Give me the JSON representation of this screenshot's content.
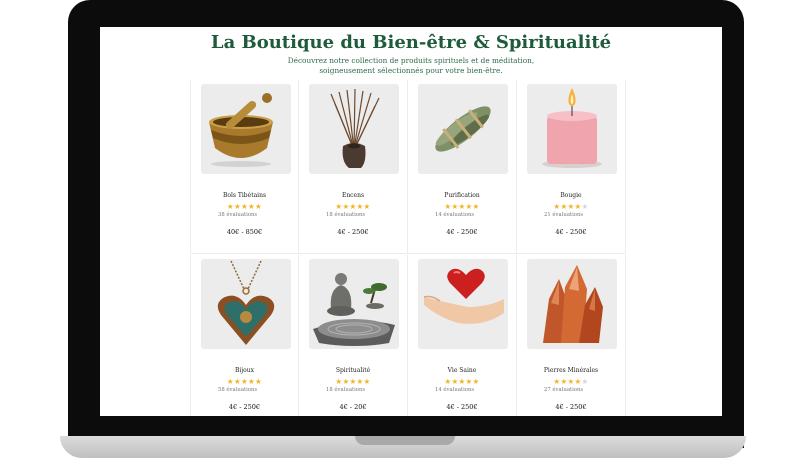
{
  "page": {
    "title": "La Boutique du Bien-être & Spiritualité",
    "subtitle_line1": "Découvrez notre collection de produits spirituels et de méditation,",
    "subtitle_line2": "soigneusement sélectionnés pour votre bien-être."
  },
  "products": [
    {
      "name": "Bols Tibétains",
      "rating": 5,
      "reviews": "38 évaluations",
      "price": "40€ - 850€",
      "image": "singing-bowl"
    },
    {
      "name": "Encens",
      "rating": 5,
      "reviews": "18 évaluations",
      "price": "4€ - 250€",
      "image": "incense-sticks"
    },
    {
      "name": "Purification",
      "rating": 5,
      "reviews": "14 évaluations",
      "price": "4€ - 250€",
      "image": "sage-bundle"
    },
    {
      "name": "Bougie",
      "rating": 4,
      "reviews": "21 évaluations",
      "price": "4€ - 250€",
      "image": "pink-candle"
    },
    {
      "name": "Bijoux",
      "rating": 5,
      "reviews": "58 évaluations",
      "price": "4€ - 250€",
      "image": "heart-pendant"
    },
    {
      "name": "Spiritualité",
      "rating": 5,
      "reviews": "18 évaluations",
      "price": "4€ - 20€",
      "image": "buddha-zen-garden"
    },
    {
      "name": "Vie Saine",
      "rating": 5,
      "reviews": "14 évaluations",
      "price": "4€ - 250€",
      "image": "heart-in-hand"
    },
    {
      "name": "Pierres Minérales",
      "rating": 4,
      "reviews": "27 évaluations",
      "price": "4€ - 250€",
      "image": "mineral-crystals"
    }
  ],
  "colors": {
    "title": "#1e5b3b",
    "star_on": "#f1b52a",
    "star_off": "#d6d6d6"
  }
}
